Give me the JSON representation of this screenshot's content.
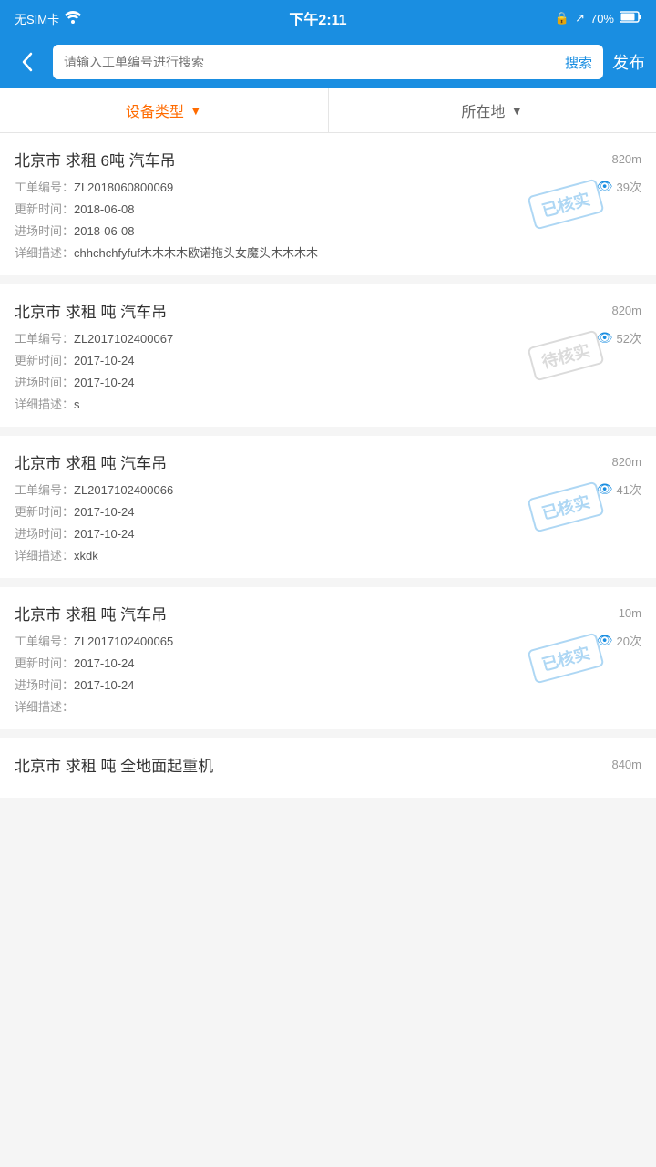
{
  "statusBar": {
    "left": "无SIM卡 ▲",
    "center": "下午2:11",
    "right": "70%"
  },
  "navBar": {
    "backIcon": "‹",
    "searchPlaceholder": "请输入工单编号进行搜索",
    "searchBtnLabel": "搜索",
    "publishLabel": "发布"
  },
  "filterBar": {
    "equipmentType": "设备类型",
    "location": "所在地"
  },
  "listItems": [
    {
      "id": 1,
      "title": "北京市 求租 6吨 汽车吊",
      "distance": "820m",
      "workOrderLabel": "工单编号：",
      "workOrderNo": "ZL2018060800069",
      "views": "39次",
      "updateLabel": "更新时间：",
      "updateTime": "2018-06-08",
      "entryLabel": "进场时间：",
      "entryTime": "2018-06-08",
      "descLabel": "详细描述：",
      "desc": "chhchchfyfuf木木木木欧诺拖头女魔头木木木木",
      "stamp": "已核实",
      "stampType": "sold"
    },
    {
      "id": 2,
      "title": "北京市 求租 吨 汽车吊",
      "distance": "820m",
      "workOrderLabel": "工单编号：",
      "workOrderNo": "ZL2017102400067",
      "views": "52次",
      "updateLabel": "更新时间：",
      "updateTime": "2017-10-24",
      "entryLabel": "进场时间：",
      "entryTime": "2017-10-24",
      "descLabel": "详细描述：",
      "desc": "s",
      "stamp": "待核实",
      "stampType": "pending"
    },
    {
      "id": 3,
      "title": "北京市 求租 吨 汽车吊",
      "distance": "820m",
      "workOrderLabel": "工单编号：",
      "workOrderNo": "ZL2017102400066",
      "views": "41次",
      "updateLabel": "更新时间：",
      "updateTime": "2017-10-24",
      "entryLabel": "进场时间：",
      "entryTime": "2017-10-24",
      "descLabel": "详细描述：",
      "desc": "xkdk",
      "stamp": "已核实",
      "stampType": "sold"
    },
    {
      "id": 4,
      "title": "北京市 求租 吨 汽车吊",
      "distance": "10m",
      "workOrderLabel": "工单编号：",
      "workOrderNo": "ZL2017102400065",
      "views": "20次",
      "updateLabel": "更新时间：",
      "updateTime": "2017-10-24",
      "entryLabel": "进场时间：",
      "entryTime": "2017-10-24",
      "descLabel": "详细描述：",
      "desc": "",
      "stamp": "已核实",
      "stampType": "sold"
    }
  ],
  "lastItem": {
    "title": "北京市 求租 吨 全地面起重机",
    "distance": "840m"
  }
}
